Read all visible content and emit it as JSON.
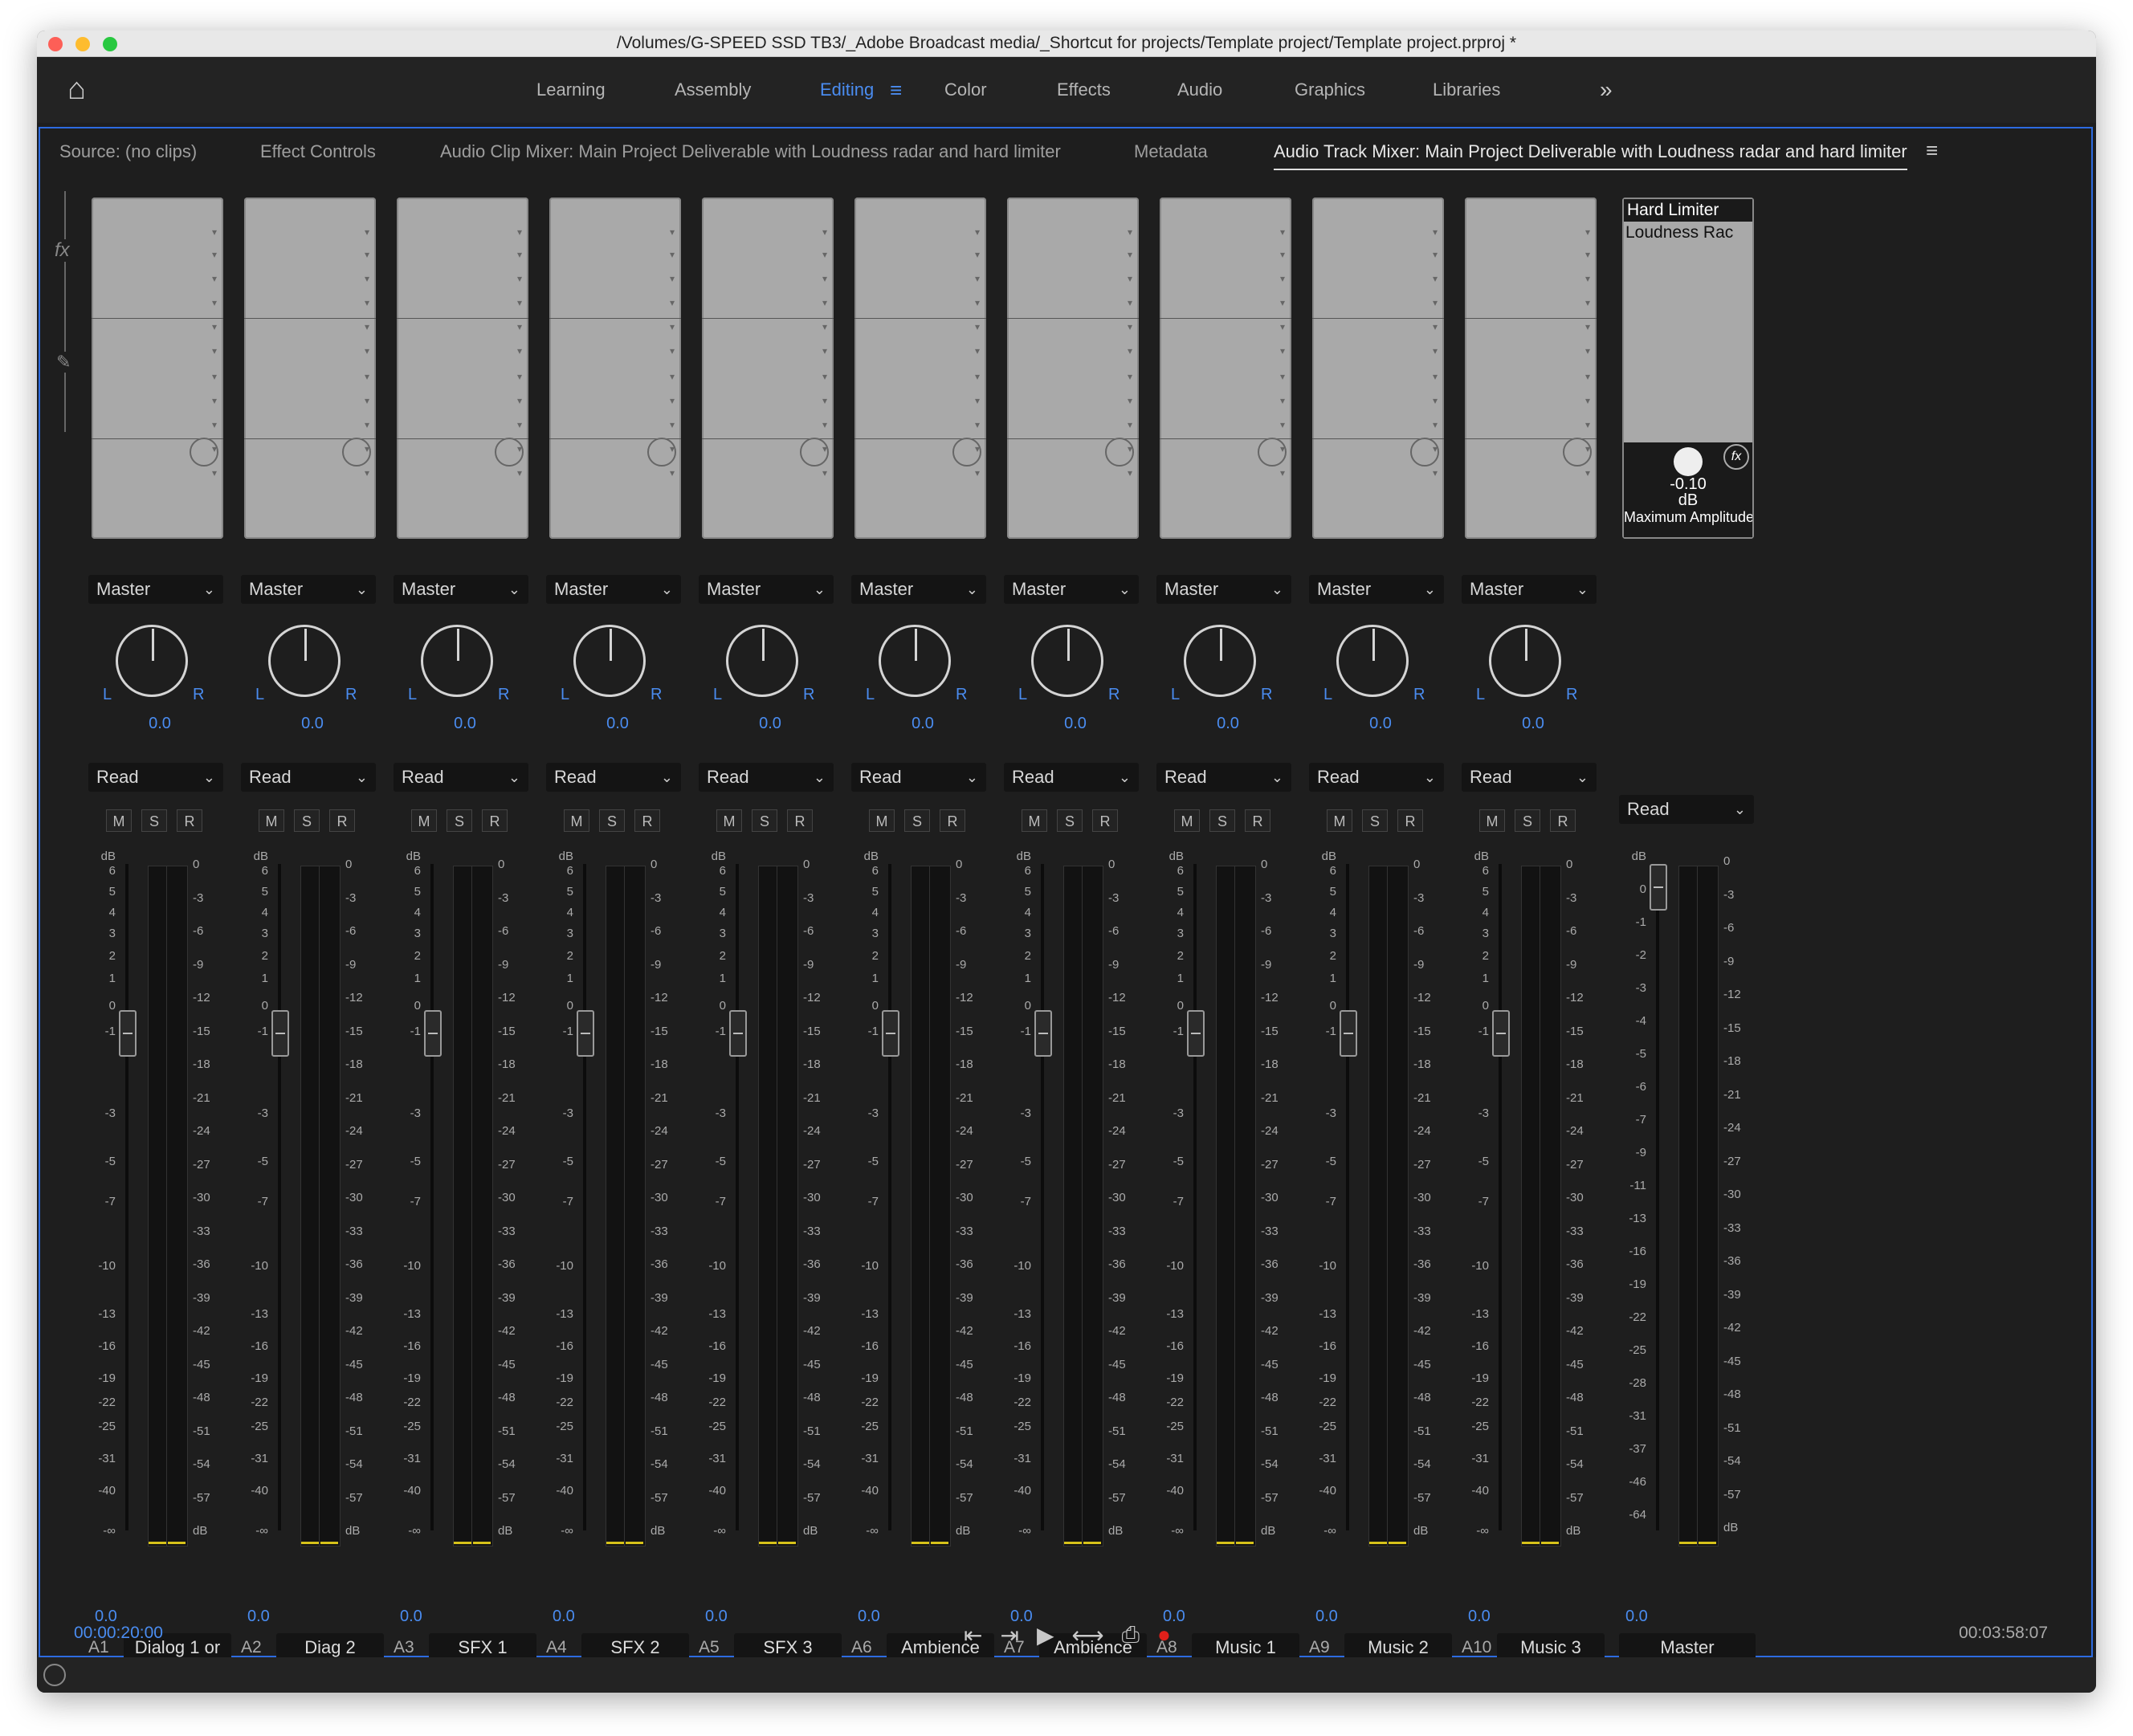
{
  "window": {
    "title": "/Volumes/G-SPEED SSD TB3/_Adobe Broadcast media/_Shortcut for projects/Template project/Template project.prproj *",
    "traffic_lights": {
      "close": "#fd5f57",
      "minimize": "#febc2e",
      "maximize": "#28c840"
    }
  },
  "workspaces": {
    "home_icon": "home-icon",
    "items": [
      "Learning",
      "Assembly",
      "Editing",
      "Color",
      "Effects",
      "Audio",
      "Graphics",
      "Libraries"
    ],
    "active": "Editing",
    "overflow_icon": "double-chevron-right-icon"
  },
  "panel_tabs": {
    "items": [
      "Source: (no clips)",
      "Effect Controls",
      "Audio Clip Mixer: Main Project Deliverable with Loudness radar and hard limiter",
      "Metadata",
      "Audio Track Mixer: Main Project Deliverable with Loudness radar and hard limiter"
    ],
    "active_index": 4,
    "menu_icon": "hamburger-menu-icon"
  },
  "left_rail": {
    "fx_label": "fx",
    "send_icon": "send-icon"
  },
  "scales": {
    "fader": [
      "dB",
      "6",
      "5",
      "4",
      "3",
      "2",
      "1",
      "0",
      "-1",
      "-3",
      "-5",
      "-7",
      "-10",
      "-13",
      "-16",
      "-19",
      "-22",
      "-25",
      "-31",
      "-40",
      "-∞"
    ],
    "meter": [
      "0",
      "-3",
      "-6",
      "-9",
      "-12",
      "-15",
      "-18",
      "-21",
      "-24",
      "-27",
      "-30",
      "-33",
      "-36",
      "-39",
      "-42",
      "-45",
      "-48",
      "-51",
      "-54",
      "-57",
      "dB"
    ],
    "master_fader": [
      "dB",
      "0",
      "-1",
      "-2",
      "-3",
      "-4",
      "-5",
      "-6",
      "-7",
      "-9",
      "-11",
      "-13",
      "-16",
      "-19",
      "-22",
      "-25",
      "-28",
      "-31",
      "-37",
      "-46",
      "-64"
    ]
  },
  "tracks": [
    {
      "id": "A1",
      "name": "Dialog 1 or",
      "output": "Master",
      "pan": "0.0",
      "automation": "Read",
      "volume": "0.0"
    },
    {
      "id": "A2",
      "name": "Diag 2",
      "output": "Master",
      "pan": "0.0",
      "automation": "Read",
      "volume": "0.0"
    },
    {
      "id": "A3",
      "name": "SFX 1",
      "output": "Master",
      "pan": "0.0",
      "automation": "Read",
      "volume": "0.0"
    },
    {
      "id": "A4",
      "name": "SFX 2",
      "output": "Master",
      "pan": "0.0",
      "automation": "Read",
      "volume": "0.0"
    },
    {
      "id": "A5",
      "name": "SFX 3",
      "output": "Master",
      "pan": "0.0",
      "automation": "Read",
      "volume": "0.0"
    },
    {
      "id": "A6",
      "name": "Ambience",
      "output": "Master",
      "pan": "0.0",
      "automation": "Read",
      "volume": "0.0"
    },
    {
      "id": "A7",
      "name": "Ambience",
      "output": "Master",
      "pan": "0.0",
      "automation": "Read",
      "volume": "0.0"
    },
    {
      "id": "A8",
      "name": "Music 1",
      "output": "Master",
      "pan": "0.0",
      "automation": "Read",
      "volume": "0.0"
    },
    {
      "id": "A9",
      "name": "Music 2",
      "output": "Master",
      "pan": "0.0",
      "automation": "Read",
      "volume": "0.0"
    },
    {
      "id": "A10",
      "name": "Music 3",
      "output": "Master",
      "pan": "0.0",
      "automation": "Read",
      "volume": "0.0"
    }
  ],
  "track_controls": {
    "mute": "M",
    "solo": "S",
    "record": "R",
    "pan_left": "L",
    "pan_right": "R"
  },
  "master": {
    "name": "Master",
    "automation": "Read",
    "volume": "0.0",
    "effects": [
      "Hard Limiter",
      "Loudness Rac"
    ],
    "param_value": "-0.10",
    "param_unit": "dB",
    "param_name": "Maximum Amplitude"
  },
  "bottom": {
    "current_time": "00:00:20:00",
    "duration": "00:03:58:07",
    "transport": [
      "go-to-in-icon",
      "go-to-out-icon",
      "play-icon",
      "loop-icon",
      "export-icon",
      "record-icon"
    ]
  }
}
